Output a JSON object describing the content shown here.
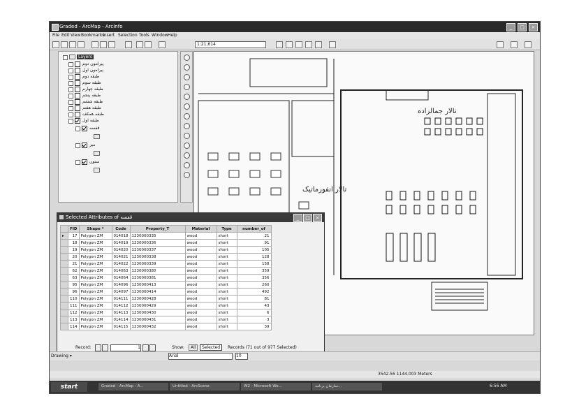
{
  "window": {
    "title": "Graded - ArcMap - ArcInfo"
  },
  "menu": [
    "File",
    "Edit",
    "View",
    "Bookmarks",
    "Insert",
    "Selection",
    "Tools",
    "Window",
    "Help"
  ],
  "toolbar": {
    "scale": "1:21,614"
  },
  "toc": {
    "root_label": "Layers",
    "layers": [
      {
        "name": "پیرامون دوم",
        "checked": false,
        "expanded": false
      },
      {
        "name": "پیرامون اول",
        "checked": false,
        "expanded": false
      },
      {
        "name": "طبقه دوم",
        "checked": false,
        "expanded": false
      },
      {
        "name": "طبقه سوم",
        "checked": false,
        "expanded": false
      },
      {
        "name": "طبقه چهارم",
        "checked": false,
        "expanded": false
      },
      {
        "name": "طبقه پنجم",
        "checked": false,
        "expanded": false
      },
      {
        "name": "طبقه ششم",
        "checked": false,
        "expanded": false
      },
      {
        "name": "طبقه هفتم",
        "checked": false,
        "expanded": false
      },
      {
        "name": "طبقه همکف",
        "checked": false,
        "expanded": false
      },
      {
        "name": "طبقه اول",
        "checked": true,
        "expanded": true
      },
      {
        "name": "قفسه",
        "checked": true,
        "expanded": true
      },
      {
        "name": "میز",
        "checked": true,
        "expanded": true
      },
      {
        "name": "ستون",
        "checked": true,
        "expanded": true
      }
    ]
  },
  "map": {
    "hall_label_1": "تالار جمالزاده",
    "hall_label_2": "تالار انفورماتیک"
  },
  "attributes": {
    "title": "Selected Attributes of قفسه",
    "columns": [
      "FID",
      "Shape *",
      "Code",
      "Property_T",
      "Material",
      "Type",
      "number_of"
    ],
    "rows": [
      [
        "17",
        "Polygon ZM",
        "014018",
        "1230000335",
        "wood",
        "short",
        "21"
      ],
      [
        "18",
        "Polygon ZM",
        "014019",
        "1230000336",
        "wood",
        "short",
        "91"
      ],
      [
        "19",
        "Polygon ZM",
        "014020",
        "1230000337",
        "wood",
        "short",
        "105"
      ],
      [
        "20",
        "Polygon ZM",
        "014021",
        "1230000338",
        "wood",
        "short",
        "128"
      ],
      [
        "21",
        "Polygon ZM",
        "014022",
        "1230000339",
        "wood",
        "short",
        "158"
      ],
      [
        "62",
        "Polygon ZM",
        "014063",
        "1230000380",
        "wood",
        "short",
        "359"
      ],
      [
        "63",
        "Polygon ZM",
        "014064",
        "1230000381",
        "wood",
        "short",
        "356"
      ],
      [
        "95",
        "Polygon ZM",
        "014096",
        "1230000413",
        "wood",
        "short",
        "260"
      ],
      [
        "96",
        "Polygon ZM",
        "014097",
        "1230000414",
        "wood",
        "short",
        "492"
      ],
      [
        "110",
        "Polygon ZM",
        "014111",
        "1230000428",
        "wood",
        "short",
        "81"
      ],
      [
        "111",
        "Polygon ZM",
        "014112",
        "1230000429",
        "wood",
        "short",
        "43"
      ],
      [
        "112",
        "Polygon ZM",
        "014113",
        "1230000430",
        "wood",
        "short",
        "6"
      ],
      [
        "113",
        "Polygon ZM",
        "014114",
        "1230000431",
        "wood",
        "short",
        "3"
      ],
      [
        "114",
        "Polygon ZM",
        "014115",
        "1230000432",
        "wood",
        "short",
        "39"
      ]
    ],
    "nav": {
      "record_label": "Record:",
      "record_value": "1",
      "show_label": "Show:",
      "all_label": "All",
      "selected_label": "Selected",
      "records_text": "Records (71 out of 977 Selected)"
    }
  },
  "drawbar": {
    "drawing_label": "Drawing ▾",
    "font": "Arial",
    "size": "10"
  },
  "status": {
    "coords": "3542.56  1144.003 Meters"
  },
  "taskbar": {
    "start": "start",
    "tasks": [
      "Graded - ArcMap - A...",
      "Untitled - ArcScene",
      "W2 - Microsoft Wo...",
      "سازمان برنامه..."
    ],
    "clock": "6:56 AM"
  }
}
